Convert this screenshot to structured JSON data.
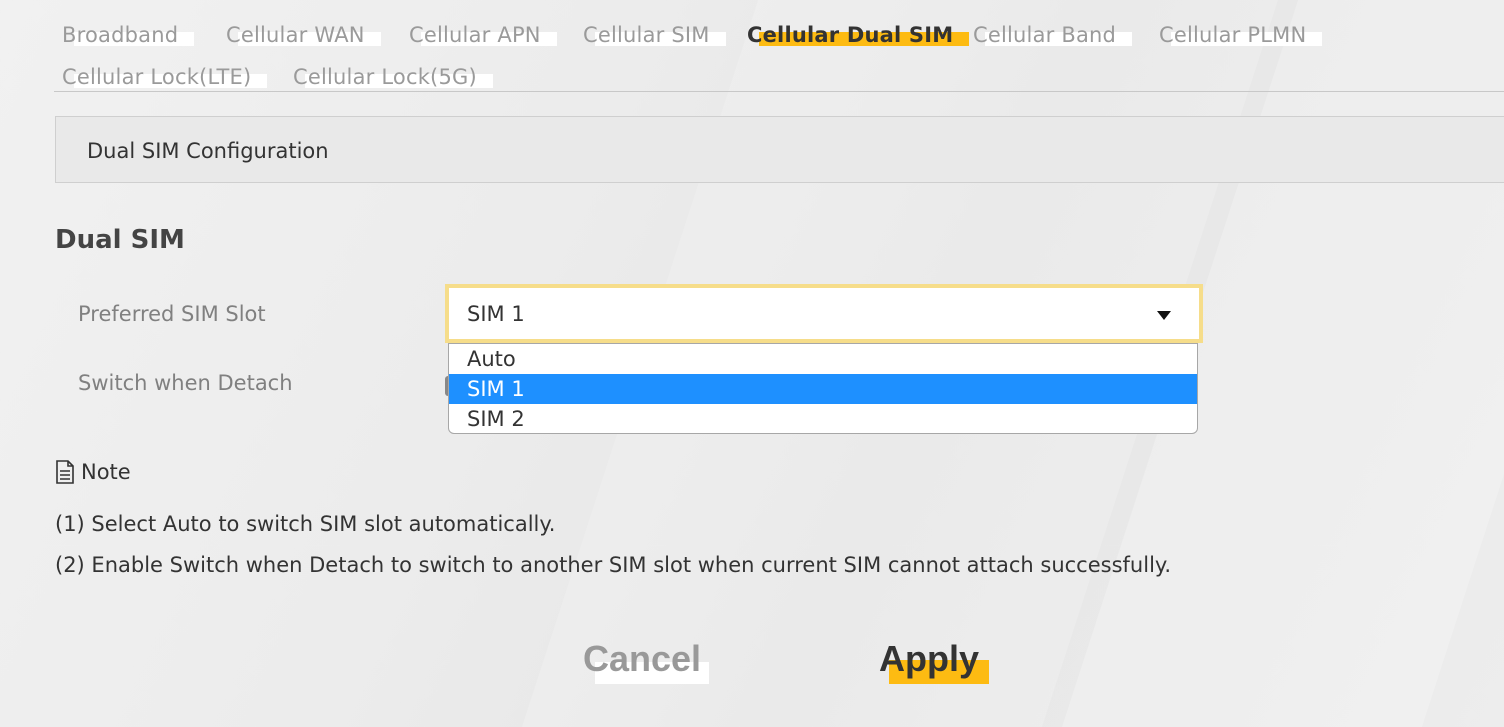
{
  "tabs": [
    {
      "label": "Broadband",
      "active": false
    },
    {
      "label": "Cellular WAN",
      "active": false
    },
    {
      "label": "Cellular APN",
      "active": false
    },
    {
      "label": "Cellular SIM",
      "active": false
    },
    {
      "label": "Cellular Dual SIM",
      "active": true
    },
    {
      "label": "Cellular Band",
      "active": false
    },
    {
      "label": "Cellular PLMN",
      "active": false
    },
    {
      "label": "Cellular Lock(LTE)",
      "active": false
    },
    {
      "label": "Cellular Lock(5G)",
      "active": false
    }
  ],
  "section": {
    "title": "Dual SIM Configuration"
  },
  "group": {
    "title": "Dual SIM"
  },
  "fields": {
    "preferred_sim_slot": {
      "label": "Preferred SIM Slot",
      "value": "SIM 1",
      "options": [
        "Auto",
        "SIM 1",
        "SIM 2"
      ],
      "highlighted": "SIM 1"
    },
    "switch_when_detach": {
      "label": "Switch when Detach"
    }
  },
  "note": {
    "title": "Note",
    "lines": [
      "(1) Select Auto to switch SIM slot automatically.",
      "(2) Enable Switch when Detach to switch to another SIM slot when current SIM cannot attach successfully."
    ]
  },
  "buttons": {
    "cancel": "Cancel",
    "apply": "Apply"
  },
  "colors": {
    "accent": "#fdbb12",
    "highlight": "#1e90ff"
  },
  "icons": {
    "note": "document-icon",
    "dropdown": "caret-down-icon"
  }
}
